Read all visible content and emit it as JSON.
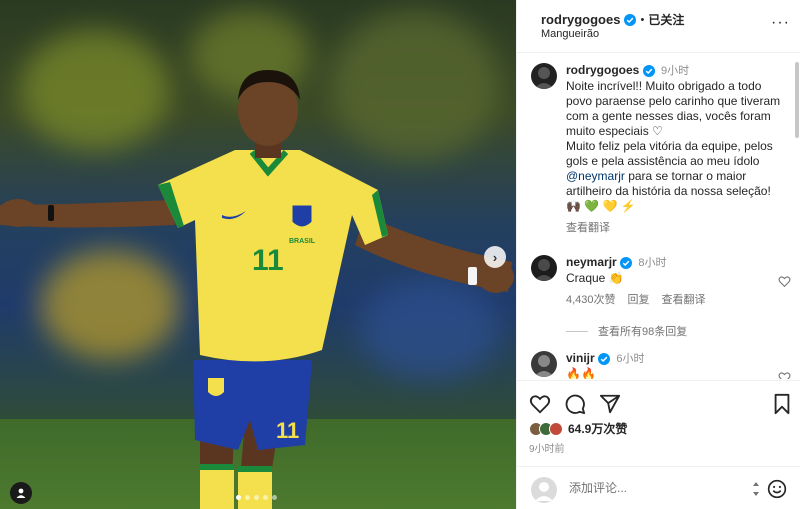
{
  "post": {
    "author": "rodrygogoes",
    "follow_status": "已关注",
    "separator": "•",
    "location": "Mangueirão",
    "more": "···"
  },
  "caption": {
    "username": "rodrygogoes",
    "time": "9小时",
    "line1": "Noite incrível!! Muito obrigado a todo povo paraense pelo carinho que tiveram com a gente nesses dias, vocês foram muito especiais ♡",
    "line2_pre": "Muito feliz pela vitória da equipe, pelos gols e pela assistência ao meu ídolo ",
    "mention": "@neymarjr",
    "line2_post": " para se tornar o maior artilheiro da história da nossa seleção! 🙌🏿 💚 💛 ⚡",
    "see_translation": "查看翻译"
  },
  "comments": [
    {
      "username": "neymarjr",
      "time": "8小时",
      "text": "Craque 👏",
      "likes": "4,430次赞",
      "reply": "回复",
      "see_translation": "查看翻译",
      "view_replies": "查看所有98条回复"
    },
    {
      "username": "vinijr",
      "time": "6小时",
      "text": "🔥🔥"
    }
  ],
  "likes": {
    "count_text": "64.9万次赞"
  },
  "post_time": "9小时前",
  "add_comment": {
    "placeholder": "添加评论..."
  },
  "icons": {
    "verified": "verified-badge-icon",
    "heart": "heart-icon",
    "comment": "comment-icon",
    "share": "share-icon",
    "save": "bookmark-icon",
    "emoji": "emoji-icon",
    "next": "chevron-right-icon",
    "user_tag": "user-tag-icon"
  },
  "colors": {
    "verified": "#0095f6",
    "mention": "#00376b",
    "brazil_yellow": "#f4e04d",
    "brazil_green": "#1a8a3a",
    "brazil_blue": "#1f3fa6"
  },
  "media": {
    "jersey_number": "11",
    "crest_text": "BRASIL",
    "next_arrow": "›",
    "carousel_position": 1,
    "carousel_count": 5
  }
}
